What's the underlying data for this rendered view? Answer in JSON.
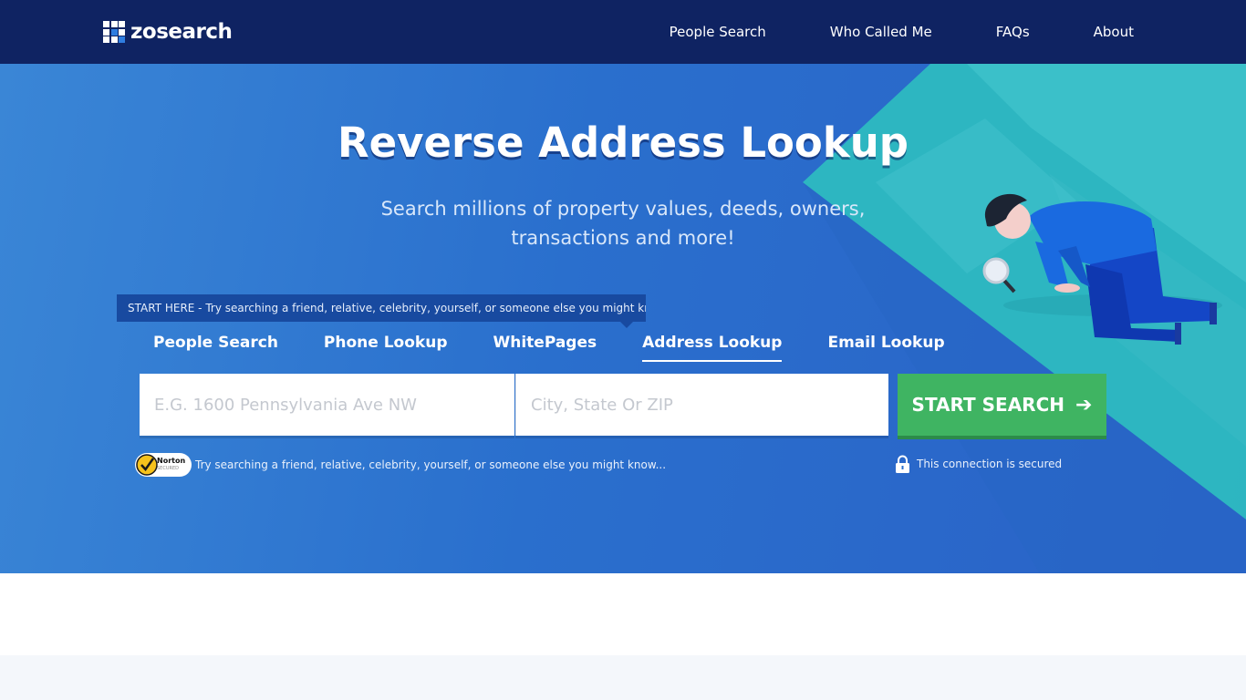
{
  "brand": {
    "name": "zosearch"
  },
  "nav": {
    "links": [
      "People Search",
      "Who Called Me",
      "FAQs",
      "About"
    ]
  },
  "hero": {
    "title": "Reverse Address Lookup",
    "subtitle": "Search millions of property values, deeds, owners, transactions and more!"
  },
  "hint": {
    "text": "START HERE - Try searching a friend, relative, celebrity, yourself, or someone else you might know..."
  },
  "tabs": {
    "items": [
      "People Search",
      "Phone Lookup",
      "WhitePages",
      "Address Lookup",
      "Email Lookup"
    ],
    "active": "Address Lookup"
  },
  "search": {
    "address_placeholder": "E.G. 1600 Pennsylvania Ave NW",
    "city_placeholder": "City, State Or ZIP",
    "button_label": "START SEARCH"
  },
  "norton": {
    "badge_title": "Norton",
    "badge_sub": "SECURED",
    "message": "Try searching a friend, relative, celebrity, yourself, or someone else you might know..."
  },
  "secure": {
    "message": "This connection is secured"
  },
  "colors": {
    "nav_bg": "#0f2362",
    "hero_blue": "#2a6fcd",
    "accent_green": "#3fb462",
    "teal": "#2ebfc0"
  },
  "icons": {
    "logo": "grid-logo-icon",
    "button": "arrow-right-icon",
    "secure": "lock-icon",
    "norton": "norton-check-icon"
  }
}
